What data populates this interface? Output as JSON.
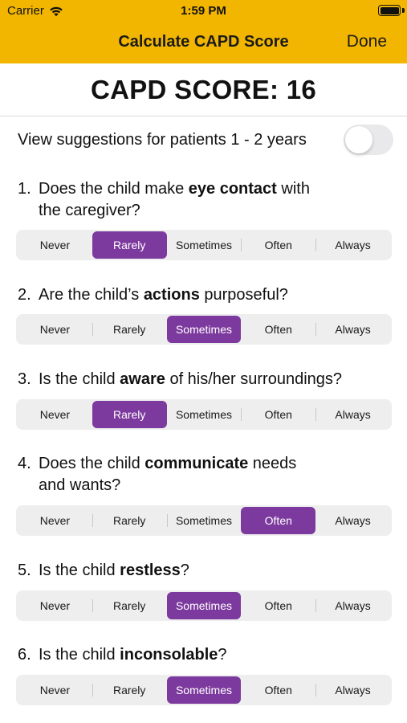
{
  "status_bar": {
    "carrier": "Carrier",
    "time": "1:59 PM"
  },
  "nav": {
    "title": "Calculate CAPD Score",
    "done_label": "Done"
  },
  "score": {
    "label": "CAPD SCORE: 16"
  },
  "suggestion_toggle": {
    "label": "View suggestions for patients 1 - 2 years",
    "on": false
  },
  "options": [
    "Never",
    "Rarely",
    "Sometimes",
    "Often",
    "Always"
  ],
  "accent_color": "#7D3A9E",
  "header_color": "#F2B600",
  "questions": [
    {
      "number": "1.",
      "line1_pre": "Does the child make ",
      "bold": "eye contact",
      "line1_post": " with",
      "line2": "the caregiver?",
      "selected": "Rarely"
    },
    {
      "number": "2.",
      "line1_pre": "Are the child’s ",
      "bold": "actions",
      "line1_post": " purposeful?",
      "line2": "",
      "selected": "Sometimes"
    },
    {
      "number": "3.",
      "line1_pre": "Is the child ",
      "bold": "aware",
      "line1_post": " of his/her surroundings?",
      "line2": "",
      "selected": "Rarely"
    },
    {
      "number": "4.",
      "line1_pre": "Does the child ",
      "bold": "communicate",
      "line1_post": " needs",
      "line2": "and wants?",
      "selected": "Often"
    },
    {
      "number": "5.",
      "line1_pre": "Is the child ",
      "bold": "restless",
      "line1_post": "?",
      "line2": "",
      "selected": "Sometimes"
    },
    {
      "number": "6.",
      "line1_pre": "Is the child ",
      "bold": "inconsolable",
      "line1_post": "?",
      "line2": "",
      "selected": "Sometimes"
    }
  ]
}
